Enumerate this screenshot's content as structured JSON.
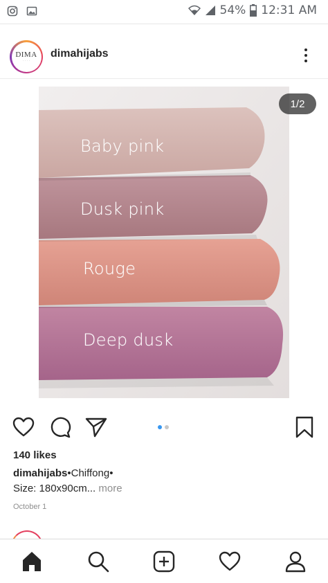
{
  "status_bar": {
    "battery": "54%",
    "time": "12:31 AM",
    "icons": [
      "instagram-notification-icon",
      "gallery-notification-icon",
      "wifi-icon",
      "signal-icon",
      "battery-icon"
    ]
  },
  "post": {
    "username": "dimahijabs",
    "avatar_brand": "DIMA",
    "image_counter": "1/2",
    "carousel": {
      "total": 2,
      "active": 1
    },
    "fabric_labels": [
      "Baby pink",
      "Dusk pink",
      "Rouge",
      "Deep dusk"
    ],
    "likes": "140 likes",
    "caption_user": "dimahijabs",
    "caption_text": "•Chiffong•",
    "caption_line2": "Size: 180x90cm...",
    "more_label": "more",
    "date": "October 1"
  },
  "actions": [
    "heart-icon",
    "comment-icon",
    "share-icon",
    "bookmark-icon"
  ],
  "bottom_nav": [
    "home-icon",
    "search-icon",
    "add-post-icon",
    "activity-heart-icon",
    "profile-icon"
  ],
  "colors": {
    "accent_blue": "#3897f0",
    "text": "#262626",
    "muted": "#8e8e8e",
    "baby_pink": "#d8b8b4",
    "dusk_pink": "#b98d96",
    "rouge": "#e09a8e",
    "deep_dusk": "#b87a98"
  }
}
